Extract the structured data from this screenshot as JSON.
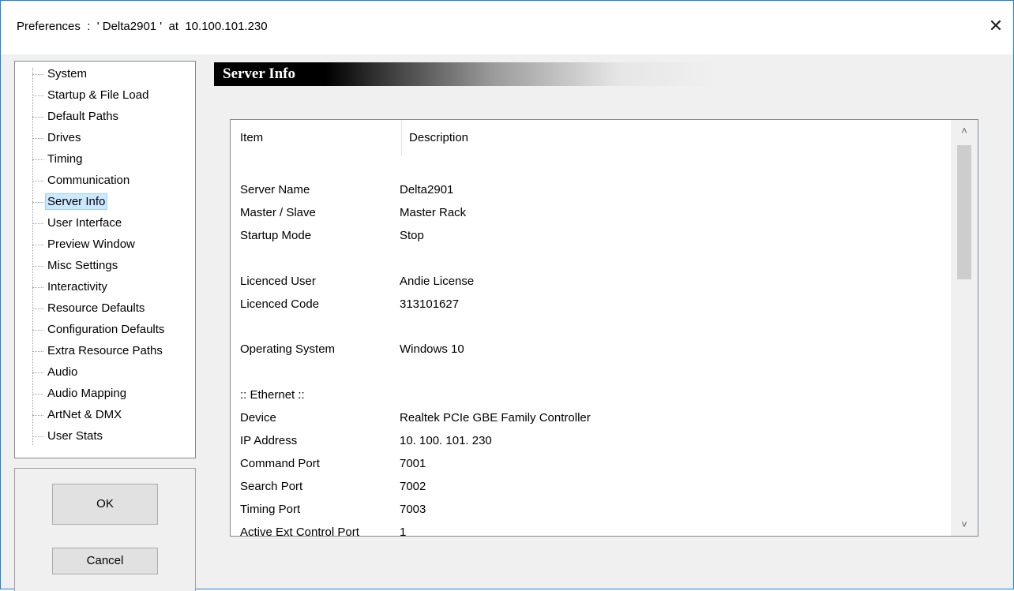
{
  "window": {
    "title": "Preferences  :  ' Delta2901 '  at  10.100.101.230",
    "close_glyph": "✕"
  },
  "tree": {
    "selected": "Server Info",
    "items": [
      {
        "label": "System"
      },
      {
        "label": "Startup & File Load"
      },
      {
        "label": "Default Paths"
      },
      {
        "label": "Drives"
      },
      {
        "label": "Timing"
      },
      {
        "label": "Communication"
      },
      {
        "label": "Server Info"
      },
      {
        "label": "User Interface"
      },
      {
        "label": "Preview Window"
      },
      {
        "label": "Misc Settings"
      },
      {
        "label": "Interactivity"
      },
      {
        "label": "Resource Defaults"
      },
      {
        "label": "Configuration Defaults"
      },
      {
        "label": "Extra Resource Paths"
      },
      {
        "label": "Audio"
      },
      {
        "label": "Audio Mapping"
      },
      {
        "label": "ArtNet & DMX"
      },
      {
        "label": "User Stats"
      }
    ]
  },
  "buttons": {
    "ok_label": "OK",
    "cancel_label": "Cancel"
  },
  "section": {
    "title": "Server Info"
  },
  "list": {
    "columns": [
      "Item",
      "Description"
    ],
    "rows": [
      {
        "item": "Server Name",
        "desc": "Delta2901"
      },
      {
        "item": "Master / Slave",
        "desc": "Master Rack"
      },
      {
        "item": "Startup Mode",
        "desc": "Stop"
      },
      {
        "item": "",
        "desc": ""
      },
      {
        "item": "Licenced User",
        "desc": "Andie License"
      },
      {
        "item": "Licenced Code",
        "desc": "313101627"
      },
      {
        "item": "",
        "desc": ""
      },
      {
        "item": "Operating System",
        "desc": "Windows 10"
      },
      {
        "item": "",
        "desc": ""
      },
      {
        "item": ":: Ethernet ::",
        "desc": ""
      },
      {
        "item": "Device",
        "desc": "Realtek PCIe GBE Family Controller"
      },
      {
        "item": "IP Address",
        "desc": "10. 100. 101. 230"
      },
      {
        "item": "Command Port",
        "desc": "7001"
      },
      {
        "item": "Search Port",
        "desc": "7002"
      },
      {
        "item": "Timing Port",
        "desc": "7003"
      },
      {
        "item": "Active Ext Control Port",
        "desc": "1"
      }
    ],
    "scroll_up_glyph": "˄",
    "scroll_down_glyph": "˅"
  },
  "icons": {
    "close": "close-icon",
    "scroll_up": "chevron-up-icon",
    "scroll_down": "chevron-down-icon"
  },
  "colors": {
    "window_border": "#1883d7",
    "selection_bg": "#cce8ff",
    "dialog_bg": "#f0f0f0"
  }
}
